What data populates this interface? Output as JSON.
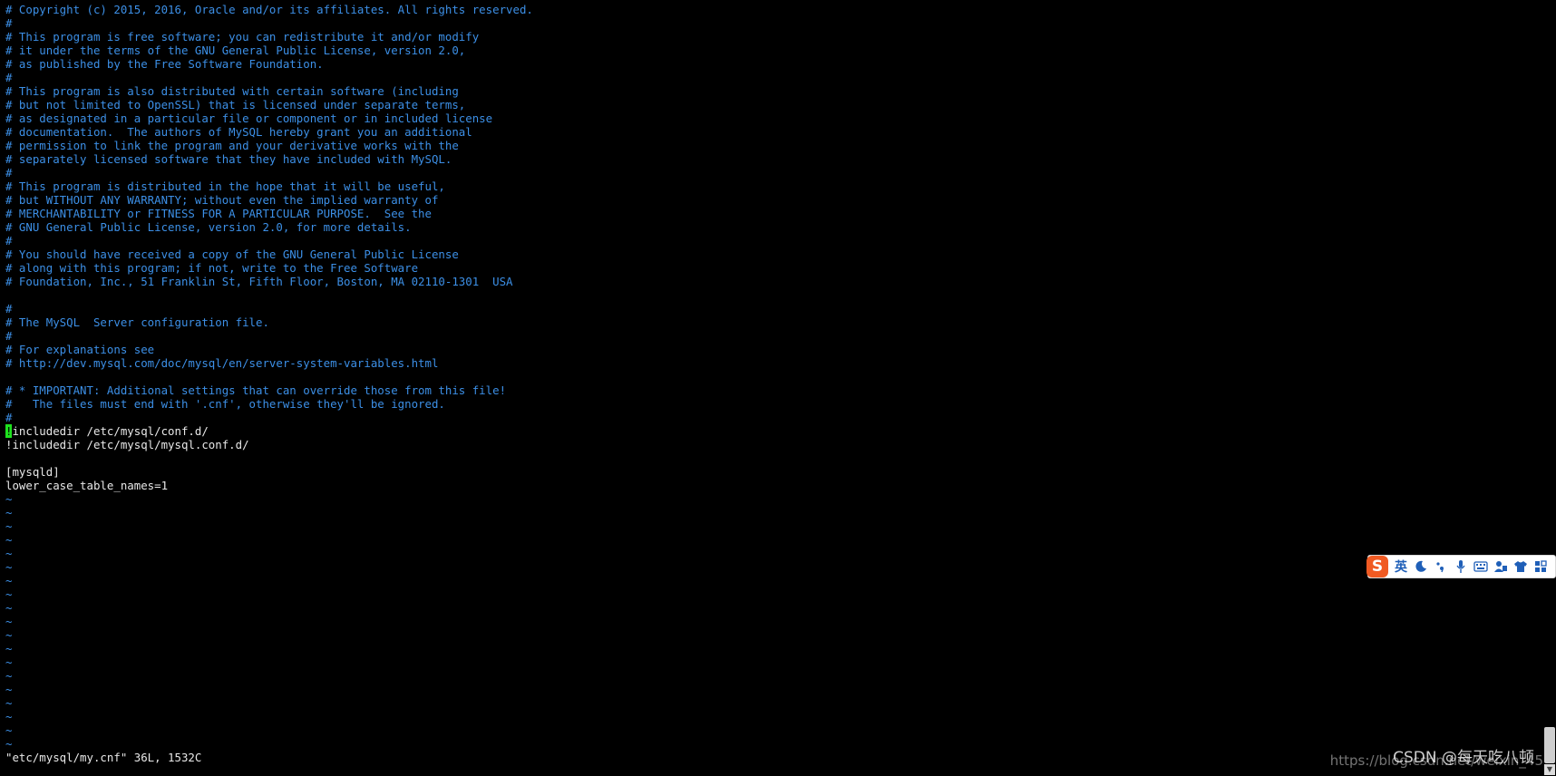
{
  "editor": {
    "lines": [
      {
        "text": "# Copyright (c) 2015, 2016, Oracle and/or its affiliates. All rights reserved.",
        "kind": "comment"
      },
      {
        "text": "#",
        "kind": "comment"
      },
      {
        "text": "# This program is free software; you can redistribute it and/or modify",
        "kind": "comment"
      },
      {
        "text": "# it under the terms of the GNU General Public License, version 2.0,",
        "kind": "comment"
      },
      {
        "text": "# as published by the Free Software Foundation.",
        "kind": "comment"
      },
      {
        "text": "#",
        "kind": "comment"
      },
      {
        "text": "# This program is also distributed with certain software (including",
        "kind": "comment"
      },
      {
        "text": "# but not limited to OpenSSL) that is licensed under separate terms,",
        "kind": "comment"
      },
      {
        "text": "# as designated in a particular file or component or in included license",
        "kind": "comment"
      },
      {
        "text": "# documentation.  The authors of MySQL hereby grant you an additional",
        "kind": "comment"
      },
      {
        "text": "# permission to link the program and your derivative works with the",
        "kind": "comment"
      },
      {
        "text": "# separately licensed software that they have included with MySQL.",
        "kind": "comment"
      },
      {
        "text": "#",
        "kind": "comment"
      },
      {
        "text": "# This program is distributed in the hope that it will be useful,",
        "kind": "comment"
      },
      {
        "text": "# but WITHOUT ANY WARRANTY; without even the implied warranty of",
        "kind": "comment"
      },
      {
        "text": "# MERCHANTABILITY or FITNESS FOR A PARTICULAR PURPOSE.  See the",
        "kind": "comment"
      },
      {
        "text": "# GNU General Public License, version 2.0, for more details.",
        "kind": "comment"
      },
      {
        "text": "#",
        "kind": "comment"
      },
      {
        "text": "# You should have received a copy of the GNU General Public License",
        "kind": "comment"
      },
      {
        "text": "# along with this program; if not, write to the Free Software",
        "kind": "comment"
      },
      {
        "text": "# Foundation, Inc., 51 Franklin St, Fifth Floor, Boston, MA 02110-1301  USA",
        "kind": "comment"
      },
      {
        "text": "",
        "kind": "normal"
      },
      {
        "text": "#",
        "kind": "comment"
      },
      {
        "text": "# The MySQL  Server configuration file.",
        "kind": "comment"
      },
      {
        "text": "#",
        "kind": "comment"
      },
      {
        "text": "# For explanations see",
        "kind": "comment"
      },
      {
        "text": "# http://dev.mysql.com/doc/mysql/en/server-system-variables.html",
        "kind": "comment"
      },
      {
        "text": "",
        "kind": "normal"
      },
      {
        "text": "# * IMPORTANT: Additional settings that can override those from this file!",
        "kind": "comment"
      },
      {
        "text": "#   The files must end with '.cnf', otherwise they'll be ignored.",
        "kind": "comment"
      },
      {
        "text": "#",
        "kind": "comment"
      },
      {
        "text": "!includedir /etc/mysql/conf.d/",
        "kind": "cursor"
      },
      {
        "text": "!includedir /etc/mysql/mysql.conf.d/",
        "kind": "normal"
      },
      {
        "text": "",
        "kind": "normal"
      },
      {
        "text": "[mysqld]",
        "kind": "normal"
      },
      {
        "text": "lower_case_table_names=1",
        "kind": "normal"
      },
      {
        "text": "~",
        "kind": "tilde"
      },
      {
        "text": "~",
        "kind": "tilde"
      },
      {
        "text": "~",
        "kind": "tilde"
      },
      {
        "text": "~",
        "kind": "tilde"
      },
      {
        "text": "~",
        "kind": "tilde"
      },
      {
        "text": "~",
        "kind": "tilde"
      },
      {
        "text": "~",
        "kind": "tilde"
      },
      {
        "text": "~",
        "kind": "tilde"
      },
      {
        "text": "~",
        "kind": "tilde"
      },
      {
        "text": "~",
        "kind": "tilde"
      },
      {
        "text": "~",
        "kind": "tilde"
      },
      {
        "text": "~",
        "kind": "tilde"
      },
      {
        "text": "~",
        "kind": "tilde"
      },
      {
        "text": "~",
        "kind": "tilde"
      },
      {
        "text": "~",
        "kind": "tilde"
      },
      {
        "text": "~",
        "kind": "tilde"
      },
      {
        "text": "~",
        "kind": "tilde"
      },
      {
        "text": "~",
        "kind": "tilde"
      },
      {
        "text": "~",
        "kind": "tilde"
      }
    ],
    "status_line": "\"etc/mysql/my.cnf\" 36L, 1532C"
  },
  "ime_toolbar": {
    "logo": "S",
    "language": "英",
    "icons": [
      "moon-icon",
      "punctuation-icon",
      "microphone-icon",
      "keyboard-icon",
      "user-icon",
      "skin-shirt-icon",
      "toolbox-icon"
    ]
  },
  "watermark": {
    "url_text": "https://blog.csdn.net/weixin_45",
    "brand_text": "CSDN @每天吃八顿"
  },
  "colors": {
    "background": "#000000",
    "comment": "#3c8fe6",
    "text": "#e8e8e8",
    "cursor": "#1ee21e",
    "ime_logo": "#f05a22"
  }
}
